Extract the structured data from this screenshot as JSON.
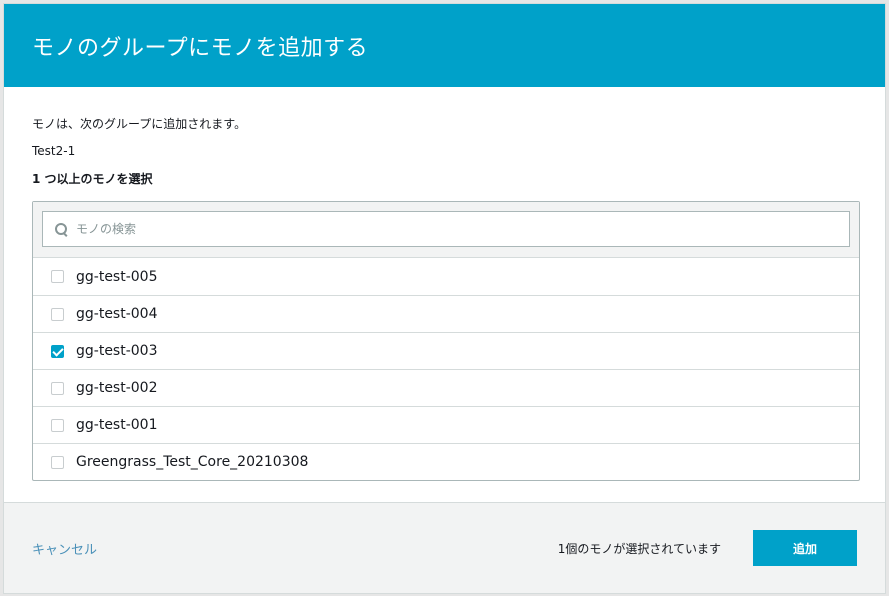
{
  "dialog": {
    "title": "モノのグループにモノを追加する",
    "description": "モノは、次のグループに追加されます。",
    "group_name": "Test2-1",
    "select_label": "1 つ以上のモノを選択",
    "search": {
      "placeholder": "モノの検索",
      "value": ""
    },
    "items": [
      {
        "label": "gg-test-005",
        "checked": false
      },
      {
        "label": "gg-test-004",
        "checked": false
      },
      {
        "label": "gg-test-003",
        "checked": true
      },
      {
        "label": "gg-test-002",
        "checked": false
      },
      {
        "label": "gg-test-001",
        "checked": false
      },
      {
        "label": "Greengrass_Test_Core_20210308",
        "checked": false
      }
    ],
    "footer": {
      "cancel_label": "キャンセル",
      "selection_count": "1個のモノが選択されています",
      "add_label": "追加"
    }
  },
  "colors": {
    "accent": "#00a1c9",
    "link": "#4a90b8"
  },
  "icons": {
    "search": "search-icon",
    "checkbox_checked": "checkmark-icon"
  }
}
